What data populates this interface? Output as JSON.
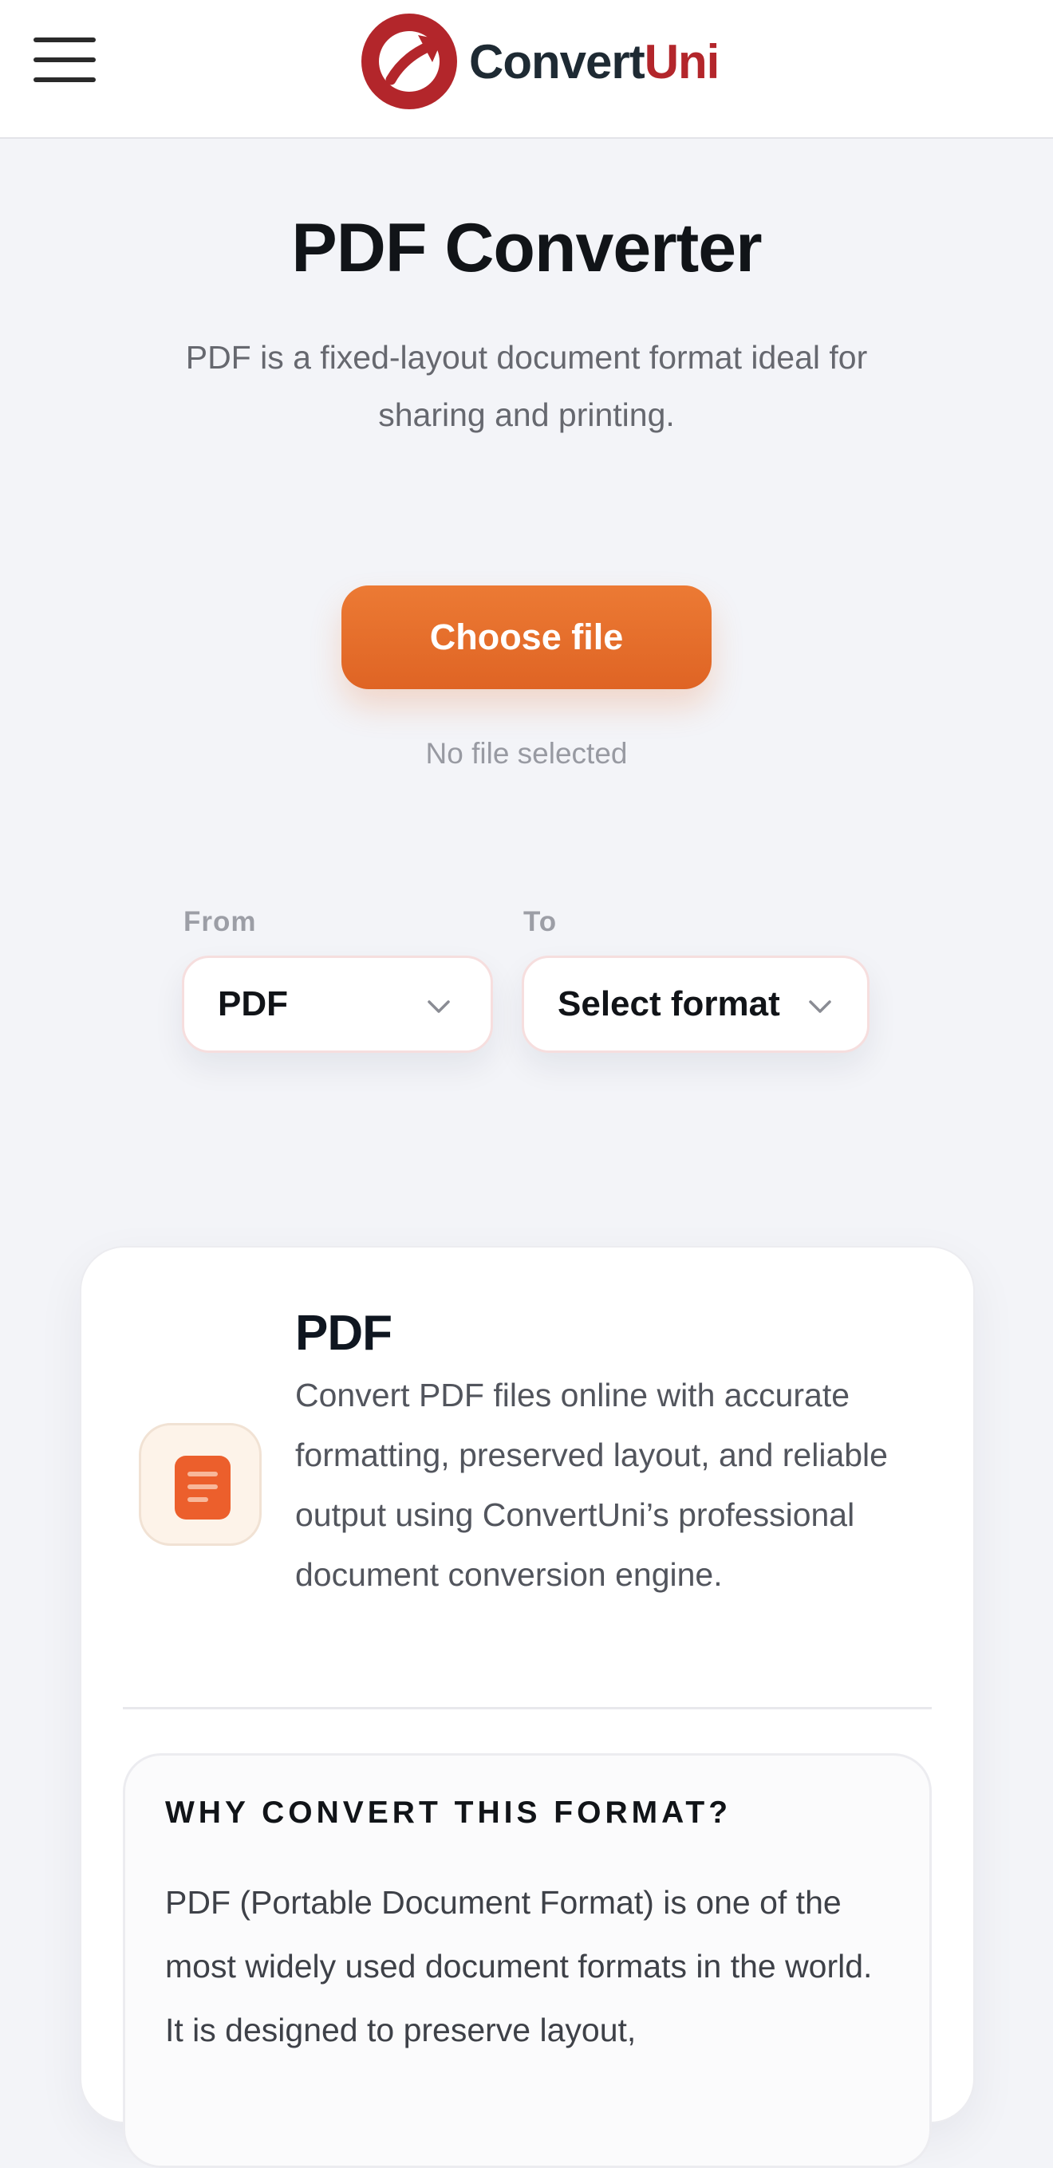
{
  "header": {
    "menu_icon": "hamburger-menu-icon",
    "logo_icon": "circular-arrow-logo-icon",
    "brand_part1": "Convert",
    "brand_part2": "Uni",
    "brand_colors": {
      "dark": "#1e2a33",
      "accent": "#b3262b"
    }
  },
  "hero": {
    "title": "PDF Converter",
    "subtitle": "PDF is a fixed-layout document format ideal for sharing and printing.",
    "choose_button": "Choose file",
    "file_status": "No file selected",
    "button_color": "#e46d2b"
  },
  "converter": {
    "from_label": "From",
    "from_value": "PDF",
    "to_label": "To",
    "to_value": "Select format",
    "chevron_icon": "chevron-down-icon"
  },
  "info_card": {
    "icon": "document-icon",
    "format_name": "PDF",
    "description": "Convert PDF files online with accurate formatting, preserved layout, and reliable output using ConvertUni’s professional document conversion engine.",
    "why_title": "WHY CONVERT THIS FORMAT?",
    "why_text": "PDF (Portable Document Format) is one of the most widely used document formats in the world. It is designed to preserve layout,"
  }
}
